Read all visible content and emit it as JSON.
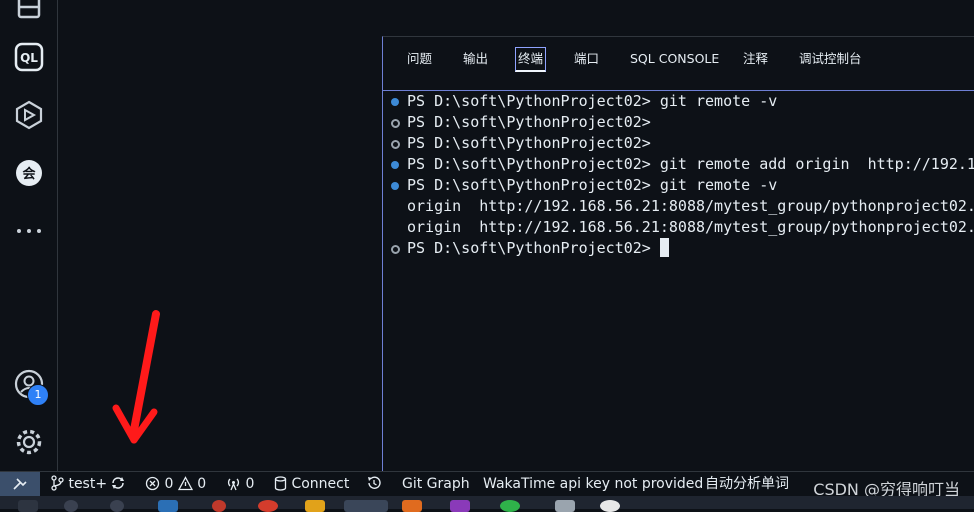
{
  "activity_bar": {
    "badge_count": "1",
    "items": [
      {
        "name": "layout-icon"
      },
      {
        "name": "ql-icon",
        "label": "QL"
      },
      {
        "name": "box-icon"
      },
      {
        "name": "meeting-icon",
        "label": "会"
      },
      {
        "name": "more-icon",
        "label": "•••"
      },
      {
        "name": "account-icon"
      },
      {
        "name": "settings-gear-icon"
      }
    ]
  },
  "panel": {
    "tabs": [
      {
        "label": "问题",
        "active": false
      },
      {
        "label": "输出",
        "active": false
      },
      {
        "label": "终端",
        "active": true
      },
      {
        "label": "端口",
        "active": false
      },
      {
        "label": "SQL CONSOLE",
        "active": false
      },
      {
        "label": "注释",
        "active": false
      },
      {
        "label": "调试控制台",
        "active": false
      }
    ]
  },
  "terminal": {
    "lines": [
      {
        "marker": "filled",
        "text": "PS D:\\soft\\PythonProject02> git remote -v"
      },
      {
        "marker": "hollow",
        "text": "PS D:\\soft\\PythonProject02>"
      },
      {
        "marker": "hollow",
        "text": "PS D:\\soft\\PythonProject02>"
      },
      {
        "marker": "filled",
        "text": "PS D:\\soft\\PythonProject02> git remote add origin  http://192.1"
      },
      {
        "marker": "filled",
        "text": "PS D:\\soft\\PythonProject02> git remote -v"
      },
      {
        "marker": "none",
        "text": "origin  http://192.168.56.21:8088/mytest_group/pythonproject02."
      },
      {
        "marker": "none",
        "text": "origin  http://192.168.56.21:8088/mytest_group/pythonproject02."
      },
      {
        "marker": "hollow",
        "text": "PS D:\\soft\\PythonProject02> "
      }
    ]
  },
  "status_bar": {
    "branch": "test+",
    "errors": "0",
    "warnings": "0",
    "ports": "0",
    "connect": "Connect",
    "git_graph": "Git Graph",
    "wakatime": "WakaTime api key not provided",
    "auto_analyze": "自动分析单词",
    "watermark": "CSDN @穷得响叮当"
  },
  "colors": {
    "background": "#0d1117",
    "accent": "#2f81f7",
    "panel_border": "#6e7fd4",
    "annotation": "#ff1a1a"
  }
}
